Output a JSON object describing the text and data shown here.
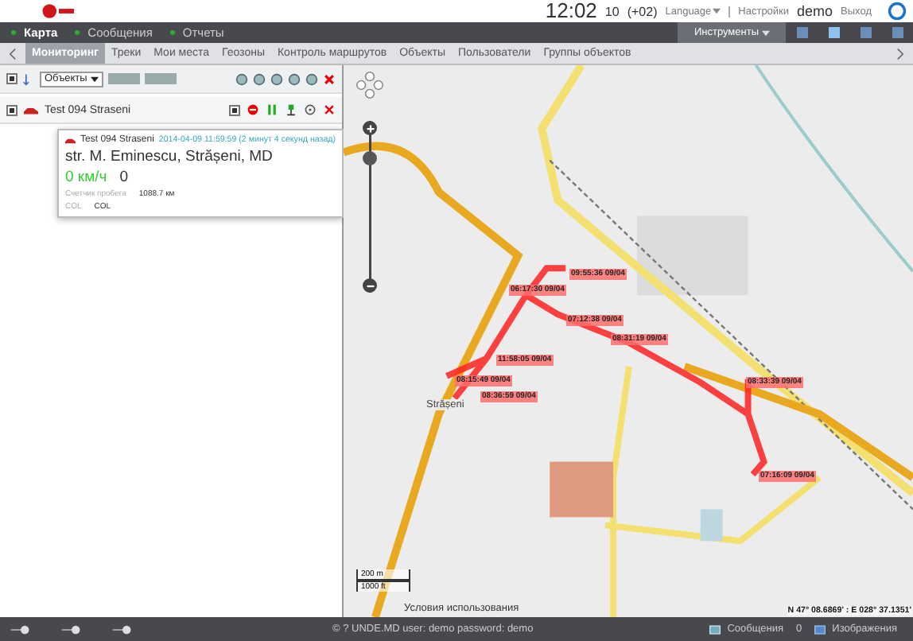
{
  "header": {
    "clock": "12:02",
    "clock_seconds": "10",
    "timezone": "(+02)",
    "language": "Language",
    "settings": "Настройки",
    "user": "demo",
    "logout": "Выход"
  },
  "menu": {
    "items": [
      {
        "label": "Карта",
        "selected": true
      },
      {
        "label": "Сообщения",
        "selected": false
      },
      {
        "label": "Отчеты",
        "selected": false
      }
    ],
    "tools": "Инструменты",
    "layouts": [
      {
        "selected": false
      },
      {
        "selected": true
      },
      {
        "selected": false
      },
      {
        "selected": false
      }
    ]
  },
  "tabs": [
    {
      "label": "Мониторинг",
      "selected": true
    },
    {
      "label": "Треки",
      "selected": false
    },
    {
      "label": "Мои места",
      "selected": false
    },
    {
      "label": "Геозоны",
      "selected": false
    },
    {
      "label": "Контроль маршрутов",
      "selected": false
    },
    {
      "label": "Объекты",
      "selected": false
    },
    {
      "label": "Пользователи",
      "selected": false
    },
    {
      "label": "Группы объектов",
      "selected": false
    }
  ],
  "panel": {
    "select_all": true,
    "filter": "Объекты",
    "units": [
      {
        "name": "Test 094 Straseni",
        "checked": true,
        "visible": true
      }
    ]
  },
  "popup": {
    "name": "Test 094 Straseni",
    "time": "2014-04-09 11:59:59 (2 минут 4 секунд назад)",
    "address": "str. M. Eminescu, Strășeni, MD",
    "speed": "0 км/ч",
    "course": "0",
    "mileage_label": "Счетчик пробега",
    "mileage": "1088.7 км",
    "sensor_label": "COL",
    "sensor_value": "COL"
  },
  "map": {
    "zoom": {
      "level": 0.78
    },
    "points": [
      {
        "label": "09:55:36 09/04"
      },
      {
        "label": "06:17:30 09/04"
      },
      {
        "label": "07:12:38 09/04"
      },
      {
        "label": "08:31:19 09/04"
      },
      {
        "label": "11:58:05 09/04"
      },
      {
        "label": "08:15:49 09/04"
      },
      {
        "label": "08:36:59 09/04"
      },
      {
        "label": "08:33:39 09/04"
      },
      {
        "label": "07:16:09 09/04"
      }
    ],
    "town": "Strășeni",
    "scale_m": "200 m",
    "scale_ft": "1000 ft",
    "terms": "Условия использования",
    "coordinates": "N 47° 08.6869' : E 028° 37.1351'"
  },
  "status_bar": {
    "footer": "© ? UNDE.MD user: demo password: demo",
    "messages": "Сообщения",
    "messages_count": "0",
    "images": "Изображения"
  }
}
